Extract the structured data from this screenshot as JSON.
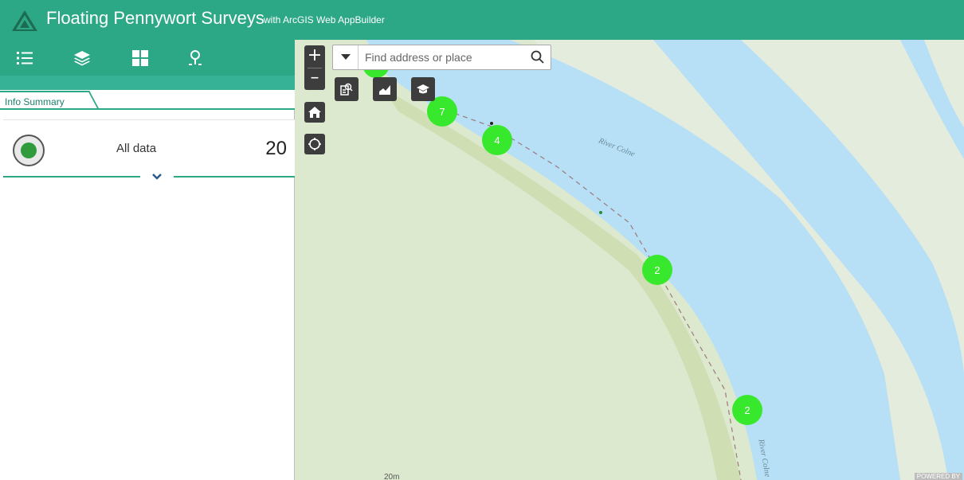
{
  "header": {
    "title": "Floating Pennywort Surveys",
    "subtitle": "with ArcGIS Web AppBuilder",
    "brand_color": "#2ca887"
  },
  "toolbar": {
    "items": [
      {
        "icon": "list-icon"
      },
      {
        "icon": "layers-icon"
      },
      {
        "icon": "grid-icon"
      },
      {
        "icon": "location-pin-icon"
      }
    ]
  },
  "tabs": {
    "active_label": "Info Summary"
  },
  "summary": {
    "label": "All data",
    "count": "20",
    "indicator_color": "#2f9b3c"
  },
  "map": {
    "search_placeholder": "Find address or place",
    "zoom_in": "+",
    "zoom_out": "–",
    "clusters": [
      {
        "count": "7"
      },
      {
        "count": "4"
      },
      {
        "count": "2"
      },
      {
        "count": "2"
      }
    ],
    "river_label_1": "River Colne",
    "river_label_2": "River Colne",
    "scale": "20m",
    "cluster_color": "#38e82c",
    "water_color": "#b7dff5",
    "land_color": "#dde9cf"
  }
}
